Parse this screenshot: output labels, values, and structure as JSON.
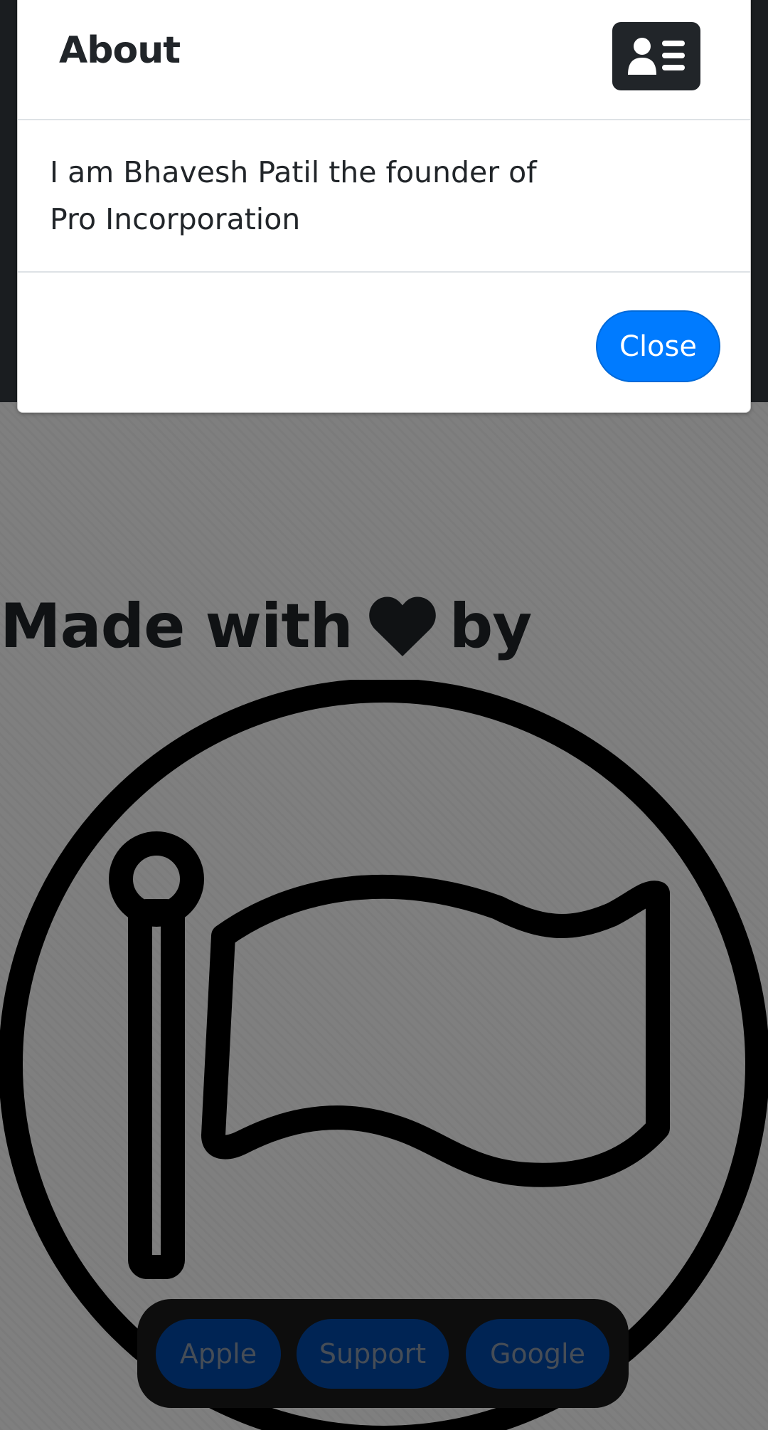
{
  "about_modal": {
    "title": "About",
    "header_icon": "address-card-icon",
    "body_text": "I am Bhavesh Patil the founder of Pro Incorporation",
    "close_label": "Close"
  },
  "page": {
    "made_with_prefix": "Made with",
    "heart_icon": "heart-icon",
    "made_with_suffix": "by",
    "logo_icon": "flag-in-circle-icon"
  },
  "bottom_nav": {
    "items": [
      {
        "label": "Apple"
      },
      {
        "label": "Support"
      },
      {
        "label": "Google"
      }
    ]
  },
  "colors": {
    "primary": "#007bff",
    "dark": "#212529",
    "navbar": "#343a40",
    "backdrop": "rgba(0,0,0,0.5)"
  }
}
